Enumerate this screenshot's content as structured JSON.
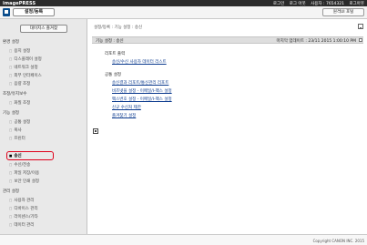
{
  "topbar": {
    "brand": "imagePRESS",
    "right_items": [
      "로그인",
      "로그 아웃",
      "사용자 : 7654321",
      "로그아웃"
    ]
  },
  "titlebar": {
    "title": "설정/등록",
    "portal_label": "원격UI 포털"
  },
  "sidebar": {
    "register_button": "대이지스 즐겨찾",
    "sections": {
      "preferences": "환경 설정",
      "adjust": "조정/유지보수",
      "functions": "기능 설정",
      "management": "관리 설정"
    },
    "items": {
      "paper": "용지 설정",
      "display": "디스플레이 설정",
      "network": "네트워크 설정",
      "external": "외부 인터페이스",
      "volume": "음량 조정",
      "image_adjust": "화질 조정",
      "common": "공통 설정",
      "copy": "복사",
      "printer": "프린터",
      "send": "송신",
      "receive_forward": "수신/전송",
      "file_access": "파일 저장/이용",
      "secure_print": "보안 인쇄 설정",
      "user_mgmt": "사용자 관리",
      "device_mgmt": "디바이스 관리",
      "license": "라이센스/기타",
      "data_mgmt": "데이터 관리"
    }
  },
  "main": {
    "breadcrumb": "설정/등록 : 기능 설정 : 송신",
    "panel_title": "기능 설정 : 송신",
    "last_updated": "마지막 업데이트 : 23/11 2015 1:00:10 PM",
    "report_group": "리포트 출력",
    "report_link": "송신/수신 사용자 데이터 리스트",
    "common_group": "공통 설정",
    "links": [
      "송신결과 리포트/통신관리 리포트",
      "비즈넷을 설정 - 이메일/I-팩스 설정",
      "팩스번호 설정 - 이메일/I-팩스 설정",
      "신규 수신처 제한",
      "즐겨찾기 설정"
    ]
  },
  "footer": {
    "copyright": "Copyright CANON INC. 2015"
  }
}
